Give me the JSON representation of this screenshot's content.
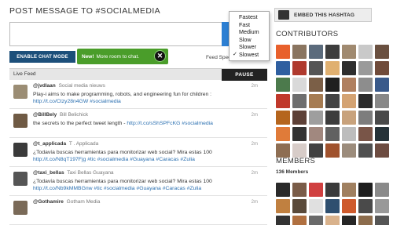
{
  "composer": {
    "title": "POST MESSAGE TO #SOCIALMEDIA",
    "enable_chat_label": "ENABLE CHAT MODE",
    "toast_bold": "New!",
    "toast_text": "More room to chat.",
    "toast_close": "✕",
    "feed_speed_label": "Feed Spee"
  },
  "speed_dropdown": {
    "options": [
      "Fastest",
      "Fast",
      "Medium",
      "Slow",
      "Slower",
      "Slowest"
    ],
    "selected": "Slowest",
    "check": "✓"
  },
  "live_feed": {
    "title": "Live Feed",
    "pause_label": "PAUSE",
    "items": [
      {
        "username": "@jvdlaan",
        "display": "Social media nieuws",
        "text": "Play-i aims to make programming, robots, and engineering fun for children : ",
        "link": "http://t.co/Ctzy28n4GW #socialmedia",
        "time": "2m",
        "avatar_color": "#9b8d74"
      },
      {
        "username": "@BillBely",
        "display": "Bill Belichick",
        "text": "the secrets to the perfect tweet length - ",
        "link": "http://t.co/sShSPFcKG #socialmedia",
        "time": "2m",
        "avatar_color": "#6f5a44"
      },
      {
        "username": "@t_applicada",
        "display": "T . Applicada",
        "text": "¿Todavía buscas herramientas para monitorizar web social? Mira estas 100 ",
        "link": "http://t.co/N8qT197Fjg #tic #socialmedia #Guayana #Caracas #Zulia",
        "time": "2m",
        "avatar_color": "#3a3a3a"
      },
      {
        "username": "@taxi_bellas",
        "display": "Taxi Bellas Guayana",
        "text": "¿Todavía buscas herramientas para monitorizar web social? Mira estas 100 ",
        "link": "http://t.co/Nb9kMMBGnw #tic #socialmedia #Guayana #Caracas #Zulia",
        "time": "2m",
        "avatar_color": "#555"
      },
      {
        "username": "@Gothamire",
        "display": "Gotham Media",
        "text": "",
        "link": "",
        "time": "2m",
        "avatar_color": "#7a6a58"
      }
    ]
  },
  "sidebar": {
    "embed_label": "EMBED THIS HASHTAG",
    "contributors_title": "CONTRIBUTORS",
    "members_title": "MEMBERS",
    "members_count": "136 Members",
    "contributor_colors": [
      "#e8602c",
      "#8a7560",
      "#5b6b7c",
      "#3d3d3d",
      "#a08a70",
      "#c9c9c9",
      "#6a5040",
      "#2f5fa0",
      "#b03a2e",
      "#555555",
      "#e0b070",
      "#2e2e2e",
      "#9a9a9a",
      "#704b3a",
      "#4c7a4c",
      "#d9d9d9",
      "#7b5f47",
      "#1f1f1f",
      "#b08060",
      "#8d8d8d",
      "#3a5a8a",
      "#c0392b",
      "#6e6e6e",
      "#a67c52",
      "#444444",
      "#d4a373",
      "#2b2b2b",
      "#888888",
      "#b5651d",
      "#5d4037",
      "#9e9e9e",
      "#3c3c3c",
      "#c8a27c",
      "#7d7d7d",
      "#4a4a4a",
      "#e07b39",
      "#333333",
      "#a1887f",
      "#616161",
      "#bdbdbd",
      "#795548",
      "#263238",
      "#8e6e53",
      "#d7ccc8",
      "#424242",
      "#a0522d",
      "#9c8c7c",
      "#505050",
      "#6d4c41"
    ],
    "member_colors": [
      "#2a2a2a",
      "#7a5c48",
      "#d04040",
      "#3b3b3b",
      "#a08060",
      "#1e1e1e",
      "#8a8a8a",
      "#c08040",
      "#5a4a3a",
      "#e0e0e0",
      "#2f4f6f",
      "#ce5a2c",
      "#4a4a4a",
      "#999999",
      "#333333",
      "#b07040",
      "#6a6a6a",
      "#d9b28c",
      "#262626",
      "#8c6c4c",
      "#555555"
    ]
  }
}
